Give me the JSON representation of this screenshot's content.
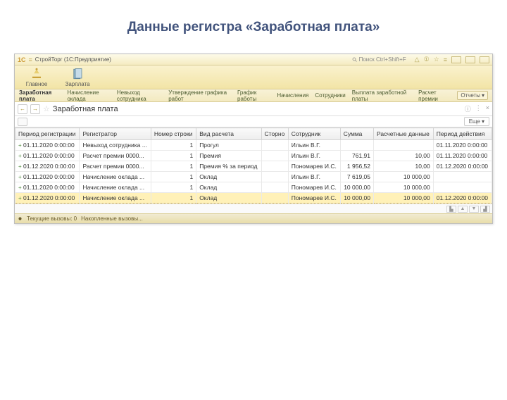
{
  "slide": {
    "title": "Данные регистра «Заработная плата»"
  },
  "titlebar": {
    "logo": "1C",
    "caption": "СтройТорг (1C:Предприятие)",
    "search_placeholder": "Поиск Ctrl+Shift+F"
  },
  "sections": {
    "main": "Главное",
    "salary": "Зарплата"
  },
  "nav": {
    "items": [
      "Заработная плата",
      "Начисление оклада",
      "Невыход сотрудника",
      "Утверждение графика работ",
      "График работы",
      "Начисления",
      "Сотрудники",
      "Выплата заработной платы",
      "Расчет премии"
    ],
    "active_index": 0,
    "reports_label": "Отчеты"
  },
  "tab": {
    "title": "Заработная плата"
  },
  "toolbar": {
    "more_label": "Еще"
  },
  "columns": [
    "Период регистрации",
    "Регистратор",
    "Номер строки",
    "Вид расчета",
    "Сторно",
    "Сотрудник",
    "Сумма",
    "Расчетные данные",
    "Период действия"
  ],
  "rows": [
    {
      "period": "01.11.2020 0:00:00",
      "reg": "Невыход сотрудника ...",
      "line": "1",
      "calc": "Прогул",
      "storno": "",
      "emp": "Ильин В.Г.",
      "sum": "",
      "aux": "",
      "valid": "01.11.2020 0:00:00"
    },
    {
      "period": "01.11.2020 0:00:00",
      "reg": "Расчет премии 0000...",
      "line": "1",
      "calc": "Премия",
      "storno": "",
      "emp": "Ильин В.Г.",
      "sum": "761,91",
      "aux": "10,00",
      "valid": "01.11.2020 0:00:00"
    },
    {
      "period": "01.12.2020 0:00:00",
      "reg": "Расчет премии 0000...",
      "line": "1",
      "calc": "Премия % за период",
      "storno": "",
      "emp": "Пономарев И.С.",
      "sum": "1 956,52",
      "aux": "10,00",
      "valid": "01.12.2020 0:00:00"
    },
    {
      "period": "01.11.2020 0:00:00",
      "reg": "Начисление оклада ...",
      "line": "1",
      "calc": "Оклад",
      "storno": "",
      "emp": "Ильин В.Г.",
      "sum": "7 619,05",
      "aux": "10 000,00",
      "valid": ""
    },
    {
      "period": "01.11.2020 0:00:00",
      "reg": "Начисление оклада ...",
      "line": "1",
      "calc": "Оклад",
      "storno": "",
      "emp": "Пономарев И.С.",
      "sum": "10 000,00",
      "aux": "10 000,00",
      "valid": ""
    },
    {
      "period": "01.12.2020 0:00:00",
      "reg": "Начисление оклада ...",
      "line": "1",
      "calc": "Оклад",
      "storno": "",
      "emp": "Пономарев И.С.",
      "sum": "10 000,00",
      "aux": "10 000,00",
      "valid": "01.12.2020 0:00:00"
    }
  ],
  "selected_row": 5,
  "status": {
    "cur_calls": "Текущие вызовы: 0",
    "stored_calls": "Накопленные вызовы..."
  }
}
